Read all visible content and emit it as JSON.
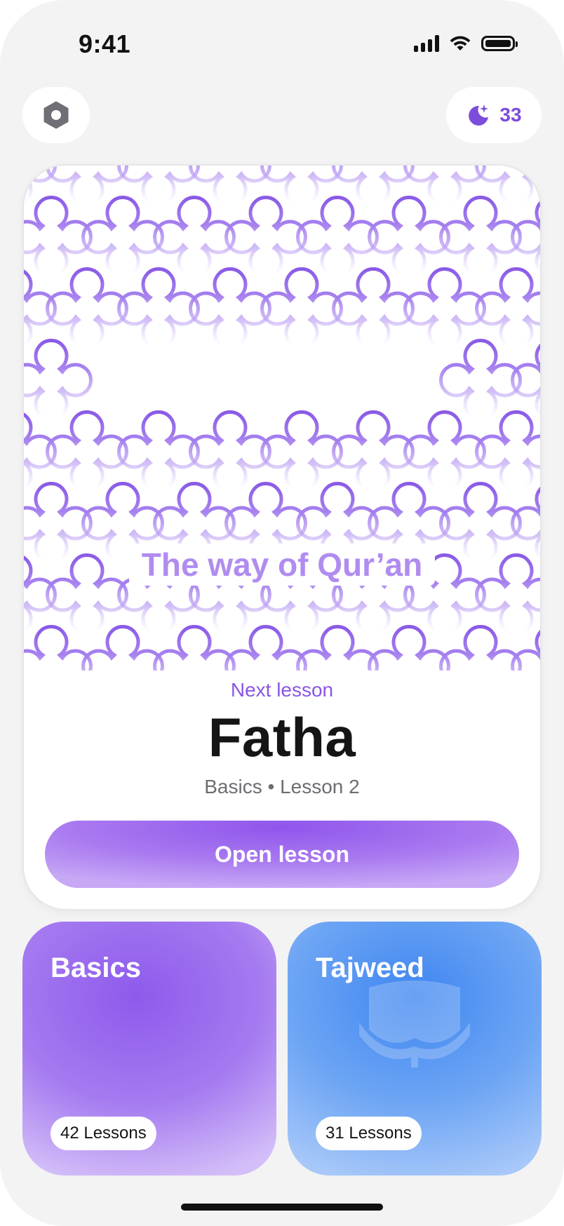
{
  "status_bar": {
    "time": "9:41",
    "icons": [
      "signal-icon",
      "wifi-icon",
      "battery-icon"
    ]
  },
  "header": {
    "settings_icon": "settings-hexagon-icon",
    "streak": {
      "icon": "moon-star-icon",
      "count": "33",
      "color": "#7c4ddb"
    }
  },
  "hero": {
    "title": "The way of Qur’an",
    "next_label": "Next lesson",
    "lesson_title": "Fatha",
    "lesson_meta": "Basics • Lesson 2",
    "button_label": "Open lesson",
    "accent": "#8a56e6"
  },
  "categories": [
    {
      "title": "Basics",
      "badge": "42 Lessons",
      "color": "#8e5aec"
    },
    {
      "title": "Tajweed",
      "badge": "31 Lessons",
      "color": "#3f86f1"
    }
  ]
}
